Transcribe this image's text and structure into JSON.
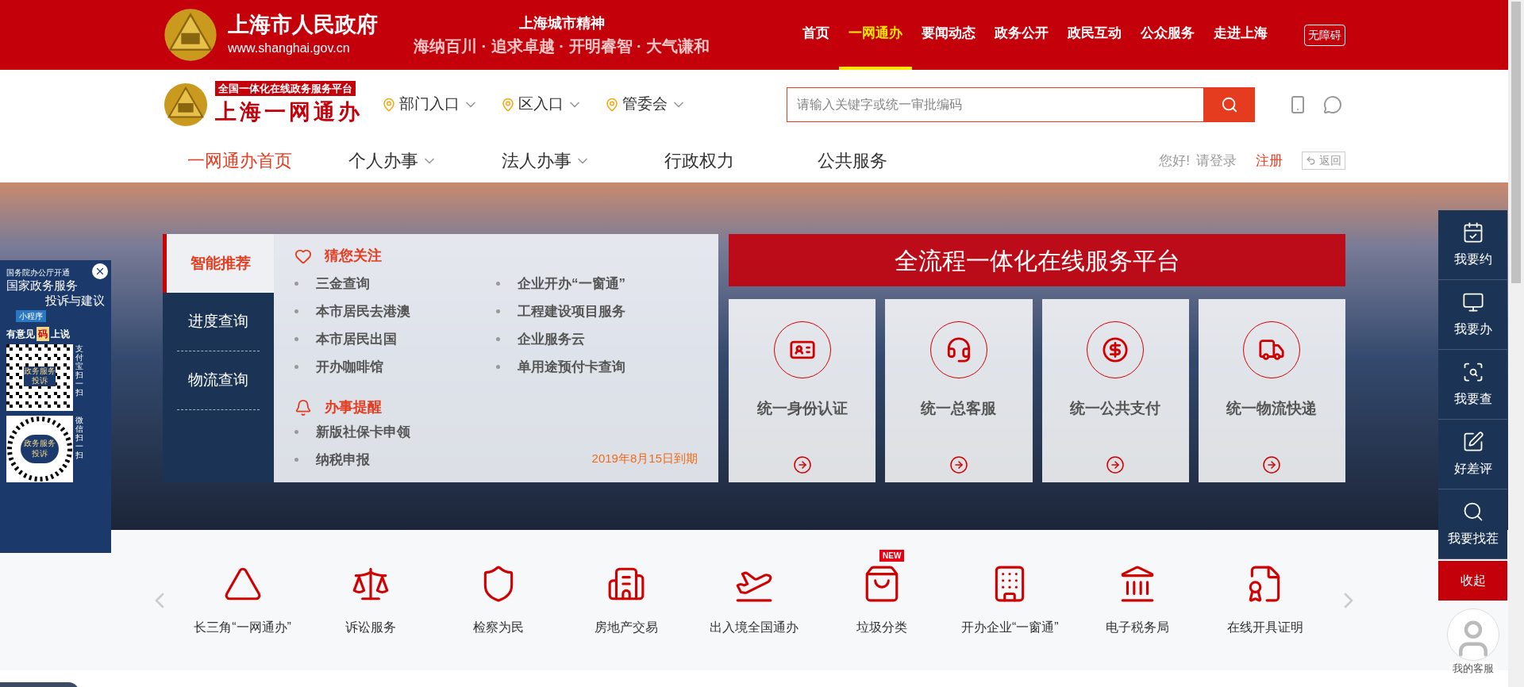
{
  "site": {
    "name": "上海市人民政府",
    "url": "www.shanghai.gov.cn",
    "spirit_title": "上海城市精神",
    "spirit": "海纳百川 · 追求卓越 · 开明睿智 · 大气谦和"
  },
  "top_nav": [
    {
      "label": "首页",
      "selected": false
    },
    {
      "label": "一网通办",
      "selected": true
    },
    {
      "label": "要闻动态",
      "selected": false
    },
    {
      "label": "政务公开",
      "selected": false
    },
    {
      "label": "政民互动",
      "selected": false
    },
    {
      "label": "公众服务",
      "selected": false
    },
    {
      "label": "走进上海",
      "selected": false
    }
  ],
  "accessibility": "无障碍",
  "portal": {
    "badge": "全国一体化在线政务服务平台",
    "name": "上海一网通办"
  },
  "entries": [
    "部门入口",
    "区入口",
    "管委会"
  ],
  "search": {
    "placeholder": "请输入关键字或统一审批编码"
  },
  "main_nav": [
    {
      "label": "一网通办首页",
      "selected": true,
      "dropdown": false
    },
    {
      "label": "个人办事",
      "selected": false,
      "dropdown": true
    },
    {
      "label": "法人办事",
      "selected": false,
      "dropdown": true
    },
    {
      "label": "行政权力",
      "selected": false,
      "dropdown": false
    },
    {
      "label": "公共服务",
      "selected": false,
      "dropdown": false
    }
  ],
  "user": {
    "greeting": "您好!",
    "login": "请登录",
    "register": "注册",
    "back": "返回"
  },
  "side_tabs": [
    {
      "label": "智能推荐",
      "selected": true
    },
    {
      "label": "进度查询",
      "selected": false
    },
    {
      "label": "物流查询",
      "selected": false
    }
  ],
  "recommend": {
    "title": "猜您关注",
    "items": [
      "三金查询",
      "本市居民去港澳",
      "本市居民出国",
      "开办咖啡馆",
      "企业开办“一窗通”",
      "工程建设项目服务",
      "企业服务云",
      "单用途预付卡查询"
    ]
  },
  "reminders": {
    "title": "办事提醒",
    "items": [
      "新版社保卡申领",
      "纳税申报"
    ],
    "expiry": "2019年8月15日到期"
  },
  "platform": {
    "title": "全流程一体化在线服务平台",
    "cards": [
      "统一身份认证",
      "统一总客服",
      "统一公共支付",
      "统一物流快递"
    ]
  },
  "services": [
    {
      "label": "长三角“一网通办”"
    },
    {
      "label": "诉讼服务"
    },
    {
      "label": "检察为民"
    },
    {
      "label": "房地产交易"
    },
    {
      "label": "出入境全国通办"
    },
    {
      "label": "垃圾分类",
      "badge": "NEW"
    },
    {
      "label": "开办企业“一窗通”"
    },
    {
      "label": "电子税务局"
    },
    {
      "label": "在线开具证明"
    }
  ],
  "float_ad": {
    "kicker": "国务院办公厅开通",
    "title_1": "国家政务服务",
    "title_2": "投诉与建议",
    "tag": "小程序",
    "say_1": "有意见",
    "say_key": "码",
    "say_2": "上说",
    "qr_labels": [
      [
        "政务服务",
        "投诉"
      ],
      [
        "政务服务",
        "投诉"
      ]
    ],
    "scan_1": "支付宝扫一扫",
    "scan_2": "微信扫一扫"
  },
  "dock": [
    "我要约",
    "我要办",
    "我要查",
    "好差评",
    "我要找茬"
  ],
  "collapse": "收起",
  "customer_service": "我的客服"
}
